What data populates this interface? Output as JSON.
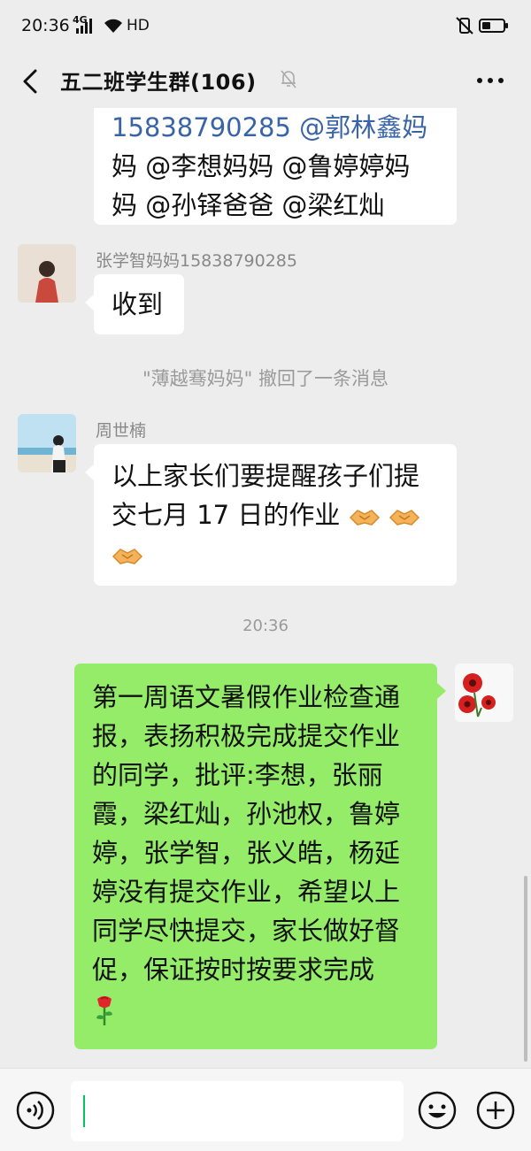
{
  "status_bar": {
    "time": "20:36",
    "network": "4G",
    "hd": "HD"
  },
  "header": {
    "title": "五二班学生群(106)"
  },
  "messages": [
    {
      "type": "received",
      "sender": "",
      "lines": [
        "15838790285 @郭林鑫妈",
        "妈 @李想妈妈 @鲁婷婷妈",
        "妈 @孙铎爸爸 @梁红灿"
      ]
    },
    {
      "type": "received",
      "sender": "张学智妈妈15838790285",
      "lines": [
        "收到"
      ]
    },
    {
      "type": "system",
      "text": "\"薄越骞妈妈\" 撤回了一条消息"
    },
    {
      "type": "received",
      "sender": "周世楠",
      "lines": [
        "以上家长们要提醒孩子们提",
        "交七月 17 日的作业"
      ]
    },
    {
      "type": "timestamp",
      "text": "20:36"
    },
    {
      "type": "sent",
      "lines": [
        "第一周语文暑假作业检查通",
        "报，表扬积极完成提交作业",
        "的同学，批评:李想，张丽",
        "霞，梁红灿，孙池权，鲁婷",
        "婷，张学智，张义皓，杨延",
        "婷没有提交作业，希望以上",
        "同学尽快提交，家长做好督",
        "促，保证按时按要求完成"
      ]
    }
  ],
  "input": {
    "placeholder": ""
  },
  "colors": {
    "background": "#ededed",
    "sent_bubble": "#95ec69",
    "received_bubble": "#ffffff",
    "cursor": "#07c160"
  },
  "icons": [
    "back-icon",
    "mute-icon",
    "more-icon",
    "voice-icon",
    "emoji-icon",
    "plus-icon",
    "handshake-icon",
    "rose-icon"
  ]
}
